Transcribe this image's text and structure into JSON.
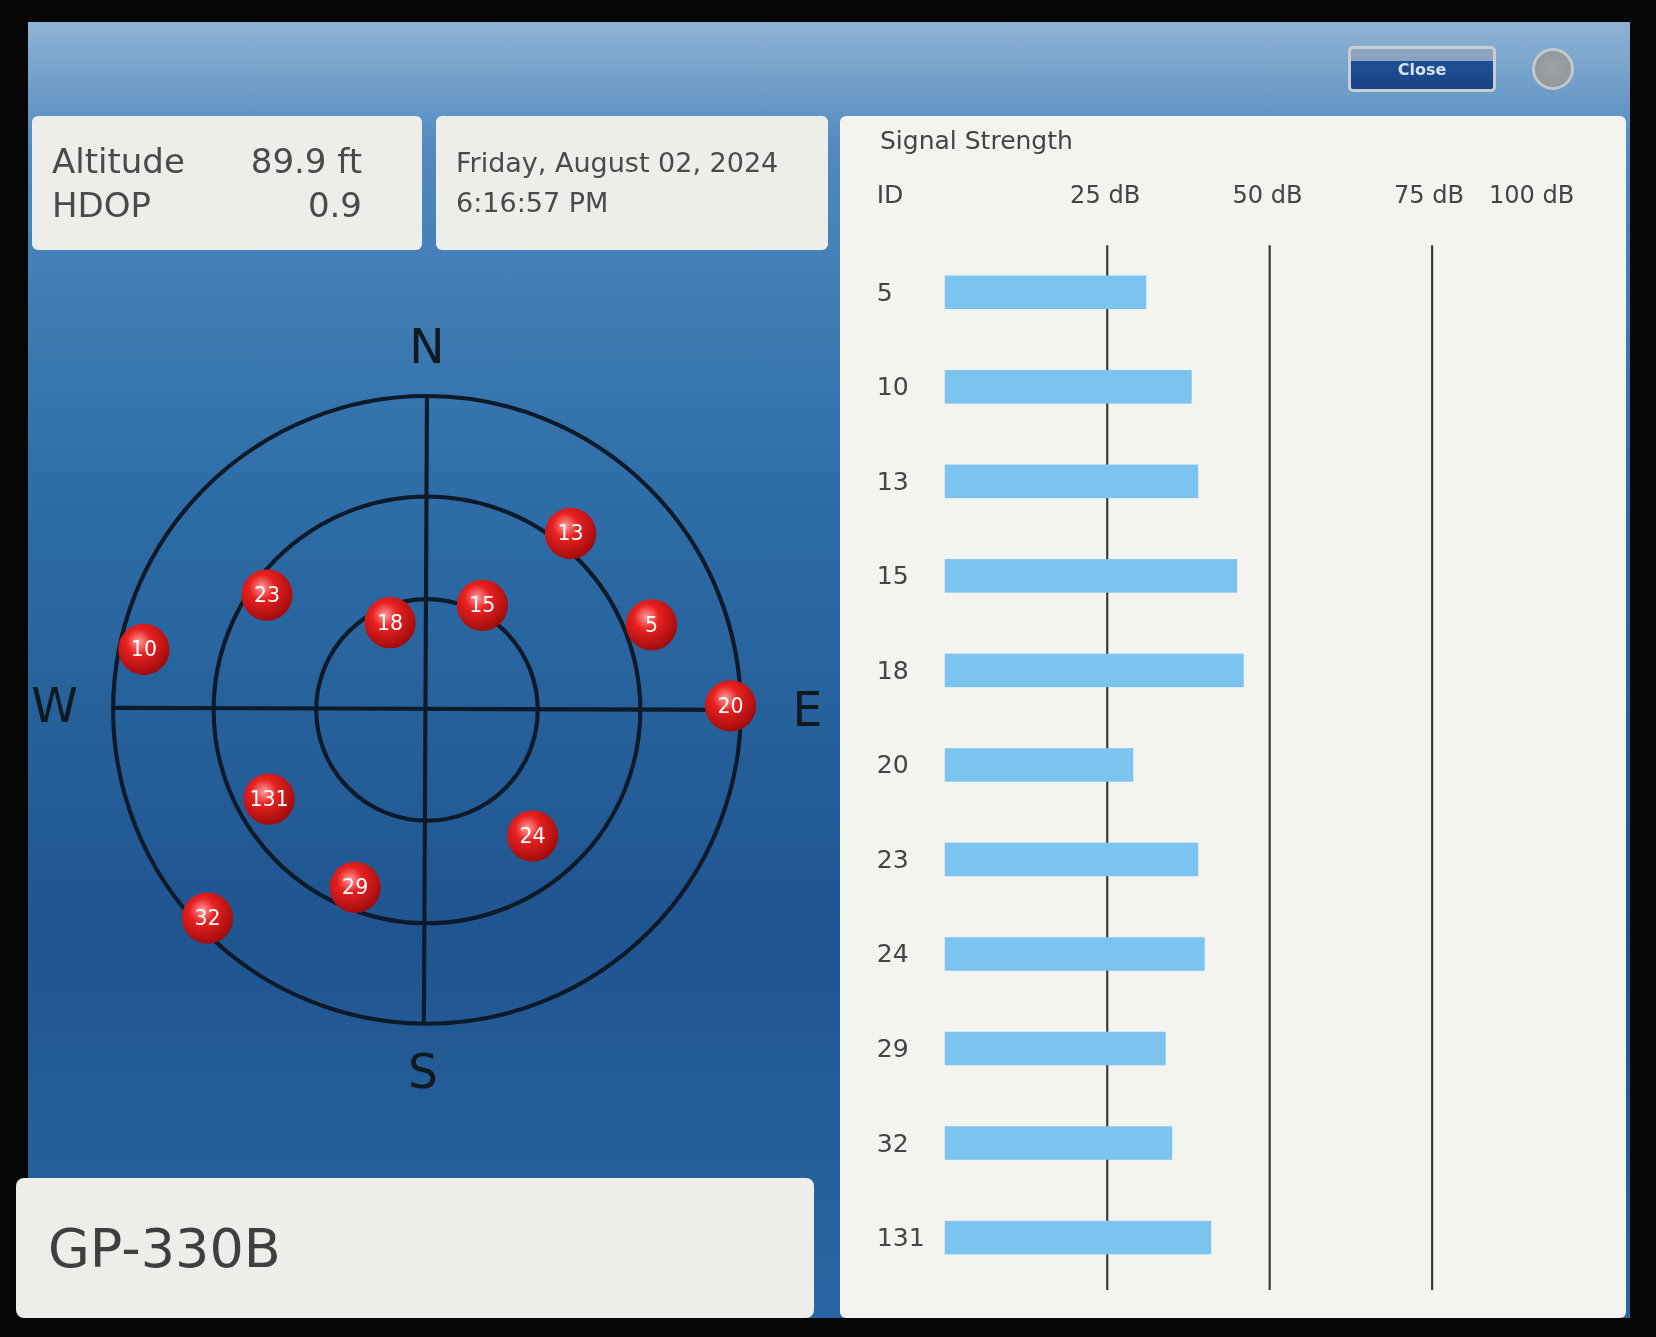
{
  "top_bar": {
    "close_button": "Close"
  },
  "position": {
    "rows": [
      {
        "label": "Altitude",
        "value": "89.9 ft"
      },
      {
        "label": "HDOP",
        "value": "0.9"
      }
    ]
  },
  "clock": {
    "date": "Friday, August 02, 2024",
    "time": "6:16:57 PM"
  },
  "sky_plot": {
    "directions": [
      "N",
      "E",
      "S",
      "W"
    ],
    "satellites": [
      {
        "id": "13"
      },
      {
        "id": "23"
      },
      {
        "id": "15"
      },
      {
        "id": "18"
      },
      {
        "id": "5"
      },
      {
        "id": "10"
      },
      {
        "id": "20"
      },
      {
        "id": "131"
      },
      {
        "id": "24"
      },
      {
        "id": "29"
      },
      {
        "id": "32"
      }
    ]
  },
  "device": {
    "model": "GP-330B"
  },
  "signal_strength": {
    "chart_data": {
      "type": "bar",
      "orientation": "horizontal",
      "title": "Signal Strength",
      "ylabel": "ID",
      "categories": [
        "5",
        "10",
        "13",
        "15",
        "18",
        "20",
        "23",
        "24",
        "29",
        "32",
        "131"
      ],
      "series": [
        {
          "color": "#7cc4f0",
          "values": [
            31,
            38,
            39,
            45,
            46,
            29,
            39,
            40,
            34,
            35,
            41
          ]
        }
      ],
      "xlim": [
        0,
        100
      ],
      "grid": true,
      "xticks": [
        {
          "value": 25,
          "label": "25 dB"
        },
        {
          "value": 50,
          "label": "50 dB"
        },
        {
          "value": 75,
          "label": "75 dB"
        },
        {
          "value": 100,
          "label": "100 dB"
        }
      ]
    }
  }
}
